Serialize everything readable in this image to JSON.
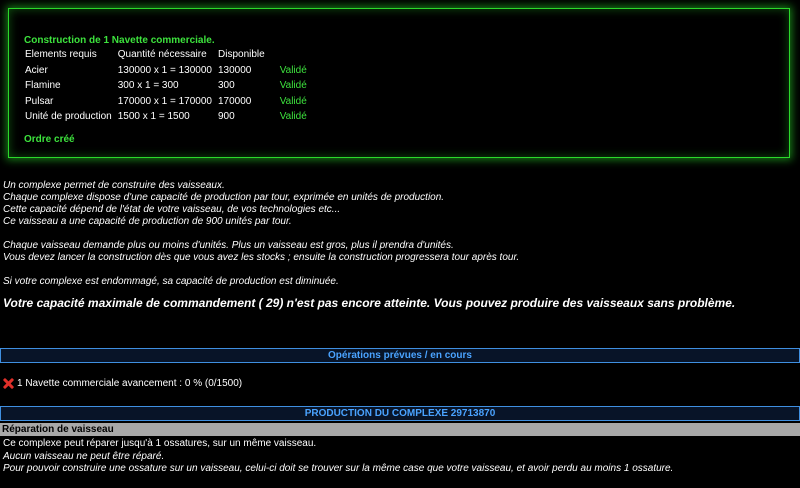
{
  "construction": {
    "title": "Construction de 1 Navette commerciale.",
    "headers": [
      "Elements requis",
      "Quantité nécessaire",
      "Disponible"
    ],
    "rows": [
      {
        "name": "Acier",
        "qty": "130000 x 1 = 130000",
        "avail": "130000",
        "status": "Validé"
      },
      {
        "name": "Flamine",
        "qty": "300 x 1 = 300",
        "avail": "300",
        "status": "Validé"
      },
      {
        "name": "Pulsar",
        "qty": "170000 x 1 = 170000",
        "avail": "170000",
        "status": "Validé"
      },
      {
        "name": "Unité de production",
        "qty": "1500 x 1 = 1500",
        "avail": "900",
        "status": "Validé"
      }
    ],
    "order": "Ordre créé"
  },
  "info": {
    "l1": "Un complexe permet de construire des vaisseaux.",
    "l2": "Chaque complexe dispose d'une capacité de production par tour, exprimée en unités de production.",
    "l3": "Cette capacité dépend de l'état de votre vaisseau, de vos technologies etc...",
    "l4": "Ce vaisseau a une capacité de production de 900 unités par tour.",
    "l5": "Chaque vaisseau demande plus ou moins d'unités. Plus un vaisseau est gros, plus il prendra d'unités.",
    "l6": "Vous devez lancer la construction dès que vous avez les stocks ; ensuite la construction progressera tour après tour.",
    "l7": "Si votre complexe est endommagé, sa capacité de production est diminuée."
  },
  "capacity": "Votre capacité maximale de commandement ( 29) n'est pas encore atteinte. Vous pouvez produire des vaisseaux sans problème.",
  "operations": {
    "title": "Opérations prévues / en cours",
    "item": "1 Navette commerciale avancement : 0 % (0/1500)",
    "cancel_icon": "cancel-x-icon"
  },
  "production": {
    "title": "PRODUCTION DU COMPLEXE 29713870"
  },
  "repair": {
    "title": "Réparation de vaisseau",
    "l1": "Ce complexe peut réparer jusqu'à 1 ossatures, sur un même vaisseau.",
    "l2": "Aucun vaisseau ne peut être réparé.",
    "l3": "Pour pouvoir construire une ossature sur un vaisseau, celui-ci doit se trouver sur la même case que votre vaisseau, et avoir perdu au moins 1 ossature."
  },
  "colors": {
    "accent_green": "#3de33d",
    "accent_blue": "#4aa3ff",
    "cancel_red": "#e0302a"
  }
}
